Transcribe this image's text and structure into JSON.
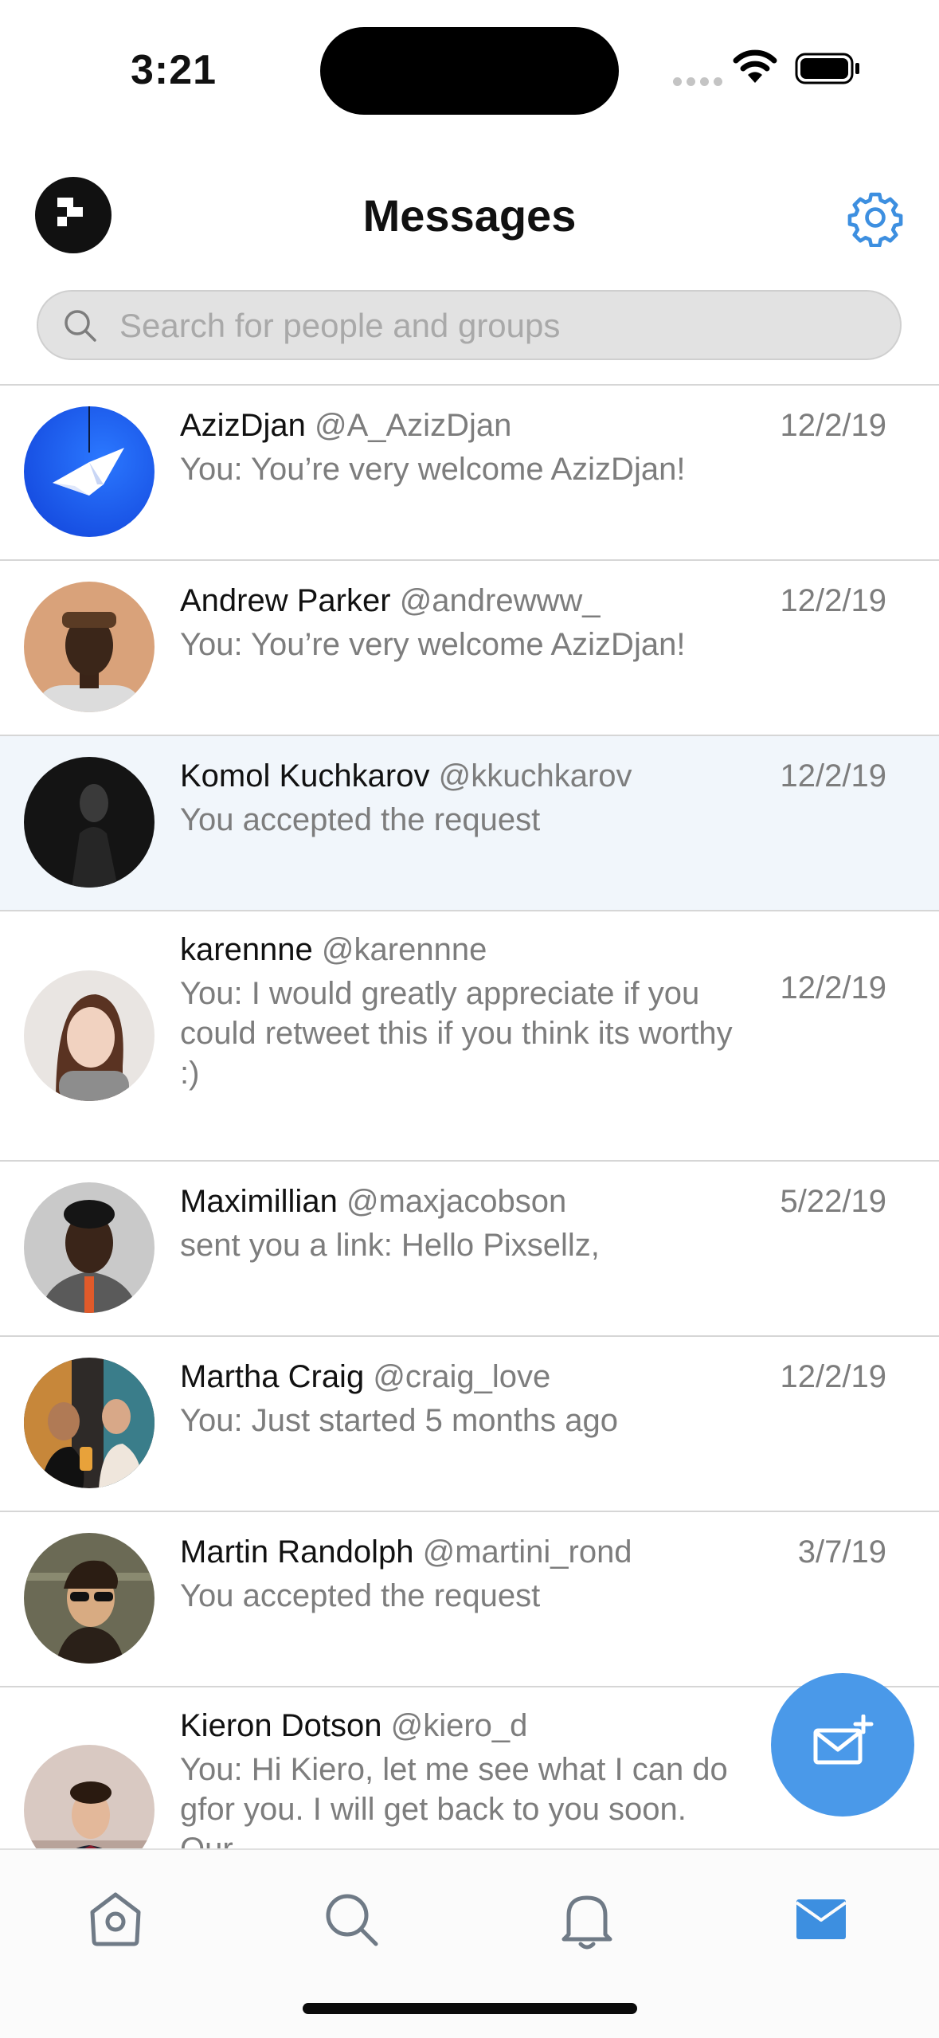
{
  "status_bar": {
    "time": "3:21"
  },
  "header": {
    "title": "Messages"
  },
  "search": {
    "placeholder": "Search for people and groups"
  },
  "conversations": [
    {
      "name": "AzizDjan",
      "handle": "@A_AzizDjan",
      "preview": "You: You’re very welcome AzizDjan!",
      "date": "12/2/19"
    },
    {
      "name": "Andrew Parker",
      "handle": "@andrewww_",
      "preview": "You: You’re very welcome AzizDjan!",
      "date": "12/2/19"
    },
    {
      "name": "Komol Kuchkarov",
      "handle": "@kkuchkarov",
      "preview": "You accepted the request",
      "date": "12/2/19",
      "selected": true
    },
    {
      "name": "karennne",
      "handle": "@karennne",
      "preview": "You: I would greatly appreciate if you could retweet this if you think its worthy :)",
      "date": "12/2/19"
    },
    {
      "name": "Maximillian",
      "handle": "@maxjacobson",
      "preview": "sent you a link: Hello Pixsellz,",
      "date": "5/22/19"
    },
    {
      "name": "Martha Craig",
      "handle": "@craig_love",
      "preview": "You: Just started 5 months ago",
      "date": "12/2/19"
    },
    {
      "name": "Martin Randolph",
      "handle": "@martini_rond",
      "preview": "You accepted the request",
      "date": "3/7/19"
    },
    {
      "name": "Kieron Dotson",
      "handle": "@kiero_d",
      "preview": "You: Hi Kiero, let me see what I can do gfor you. I will get back to you soon. Our",
      "date": ""
    }
  ],
  "tabs": [
    {
      "icon": "home-icon",
      "active": false
    },
    {
      "icon": "search-icon",
      "active": false
    },
    {
      "icon": "bell-icon",
      "active": false
    },
    {
      "icon": "mail-icon",
      "active": true
    }
  ],
  "colors": {
    "accent": "#4a99e9",
    "selected_row": "#f1f6fb",
    "secondary_text": "#7d7d7d"
  }
}
